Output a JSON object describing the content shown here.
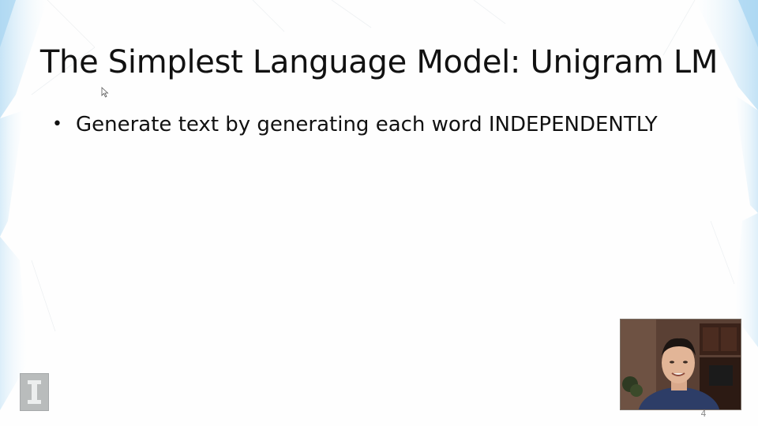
{
  "slide": {
    "title": "The Simplest Language Model: Unigram LM",
    "bullets": [
      {
        "bullet_symbol": "•",
        "text": "Generate text by generating each word INDEPENDENTLY"
      }
    ],
    "page_number": "4"
  },
  "decor": {
    "logo_icon": "university-block-i-logo-icon",
    "webcam": "presenter-webcam-video",
    "cursor_icon": "mouse-pointer-icon"
  },
  "colors": {
    "background": "#fefefe",
    "accent_blue": "#c9e6f7",
    "text": "#111111"
  }
}
